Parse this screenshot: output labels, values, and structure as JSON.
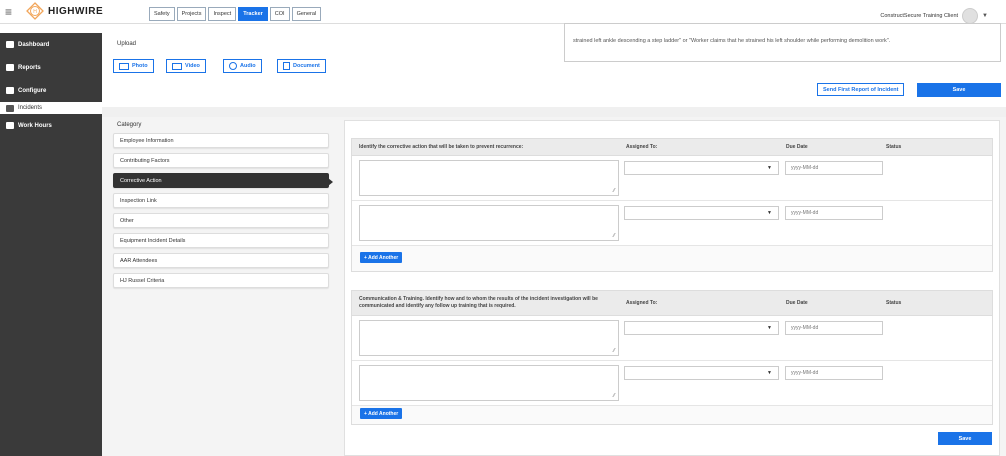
{
  "header": {
    "menu_icon": "hamburger-icon",
    "logo_text": "HIGHWIRE",
    "tabs": [
      {
        "label": "Safety"
      },
      {
        "label": "Projects"
      },
      {
        "label": "Inspect"
      },
      {
        "label": "Tracker",
        "active": true
      },
      {
        "label": "COI"
      },
      {
        "label": "General"
      }
    ],
    "client_name": "ConstructSecure Training Client",
    "accent": "#1a73e8"
  },
  "sidebar": {
    "items": [
      {
        "label": "Dashboard",
        "icon": "dashboard-icon"
      },
      {
        "label": "Reports",
        "icon": "reports-icon"
      },
      {
        "label": "Configure",
        "icon": "gear-icon"
      },
      {
        "label": "Incidents",
        "icon": "incidents-icon",
        "selected": true
      },
      {
        "label": "Work Hours",
        "icon": "clock-icon"
      }
    ]
  },
  "upload": {
    "label": "Upload",
    "buttons": [
      {
        "label": "Photo",
        "icon": "photo-icon"
      },
      {
        "label": "Video",
        "icon": "video-icon"
      },
      {
        "label": "Audio",
        "icon": "audio-icon"
      },
      {
        "label": "Document",
        "icon": "document-icon"
      }
    ]
  },
  "description_text": "strained left ankle descending a step ladder\" or \"Worker claims that he strained his left shoulder while performing demolition work\".",
  "actions": {
    "send_first_report": "Send First Report of Incident",
    "save": "Save"
  },
  "category": {
    "title": "Category",
    "items": [
      {
        "label": "Employee Information"
      },
      {
        "label": "Contributing Factors"
      },
      {
        "label": "Corrective Action",
        "active": true
      },
      {
        "label": "Inspection Link"
      },
      {
        "label": "Other"
      },
      {
        "label": "Equipment Incident Details"
      },
      {
        "label": "AAR Attendees"
      },
      {
        "label": "HJ Russel Criteria"
      }
    ]
  },
  "corrective_section": {
    "header_desc": "Identify the corrective action that will be taken to prevent recurrence:",
    "header_assigned": "Assigned To:",
    "header_due": "Due Date",
    "header_status": "Status",
    "date_placeholder": "yyyy-MM-dd",
    "add_label": "+ Add Another"
  },
  "communication_section": {
    "header_desc": "Communication & Training. Identify how and to whom the results of the incident investigation will be communicated and identify any follow up training that is required.",
    "header_assigned": "Assigned To:",
    "header_due": "Due Date",
    "header_status": "Status",
    "date_placeholder": "yyyy-MM-dd",
    "add_label": "+ Add Another"
  },
  "save_bottom": "Save"
}
